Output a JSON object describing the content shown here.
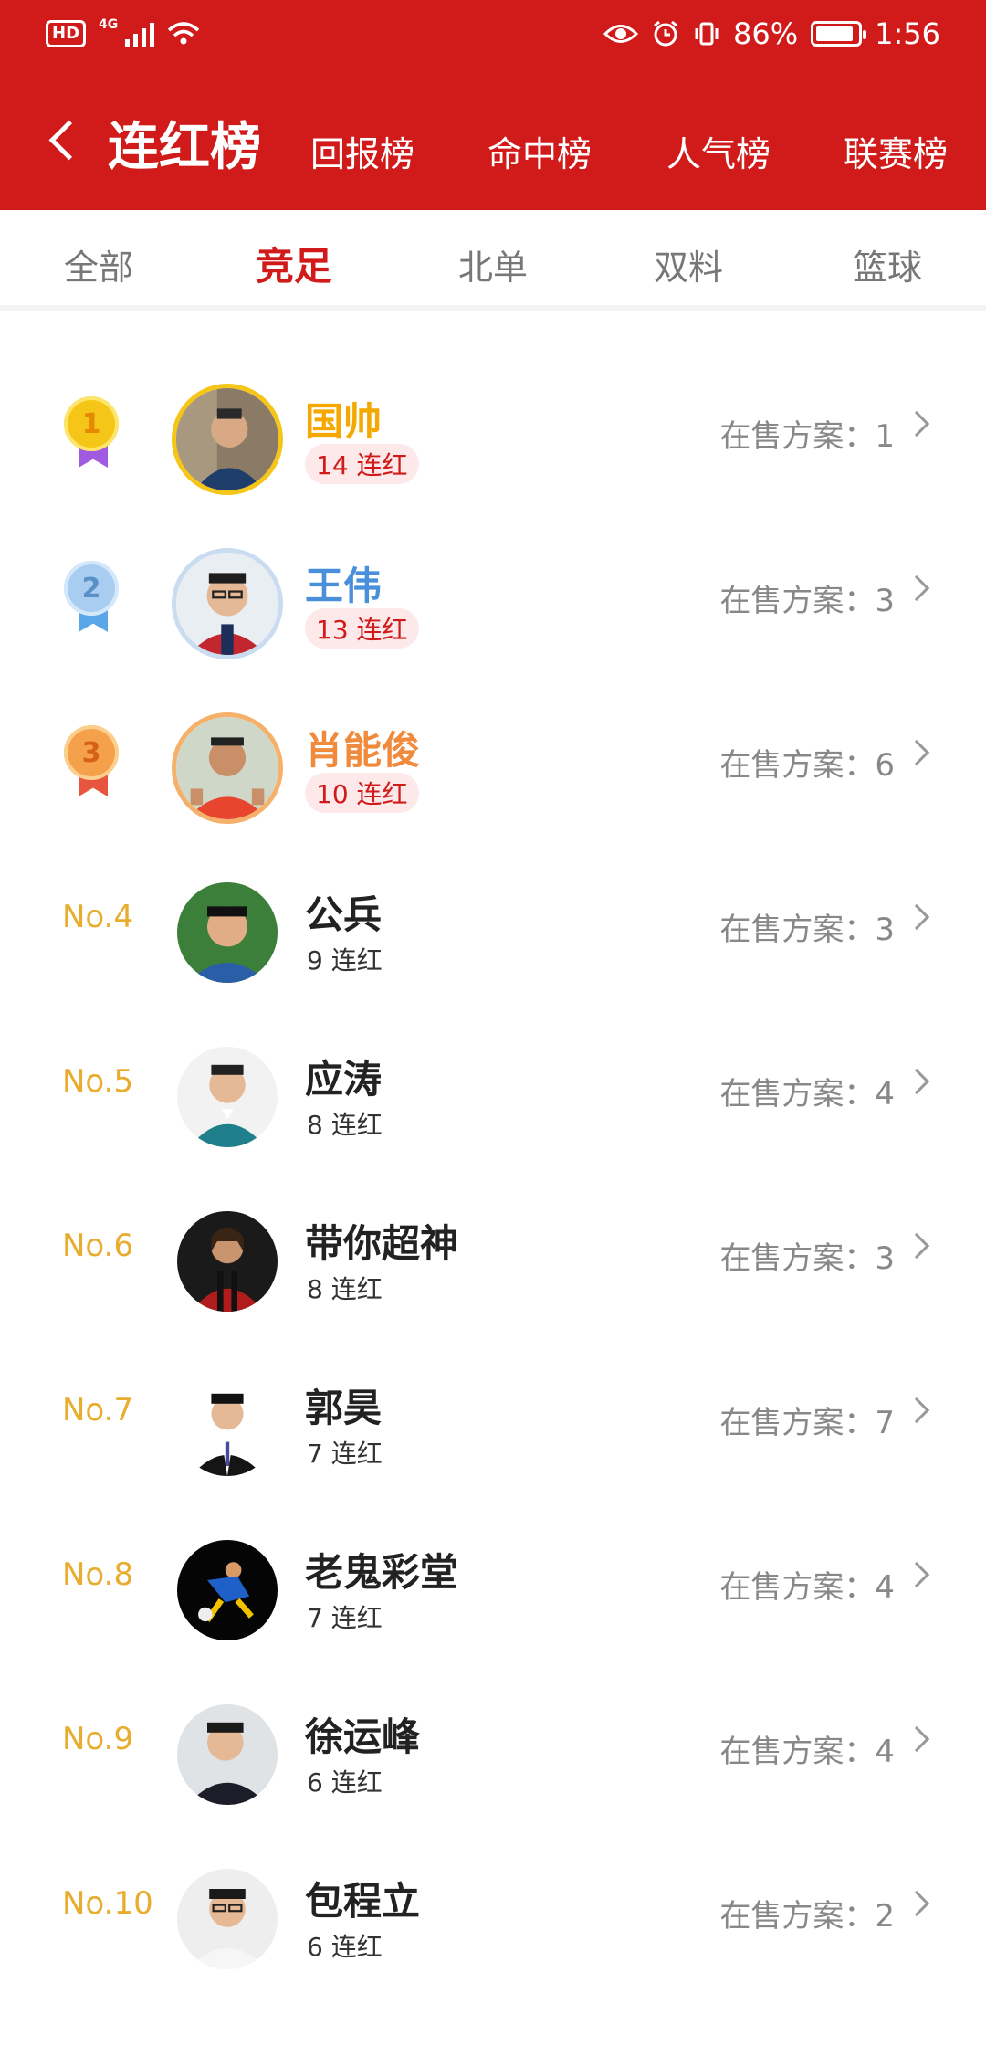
{
  "status_bar": {
    "hd": "HD",
    "network": "4G",
    "battery": "86%",
    "time": "1:56"
  },
  "nav": {
    "title": "连红榜",
    "tabs": [
      "回报榜",
      "命中榜",
      "人气榜",
      "联赛榜"
    ]
  },
  "subtabs": {
    "items": [
      "全部",
      "竞足",
      "北单",
      "双料",
      "篮球"
    ],
    "active": "竞足"
  },
  "onsale_label": "在售方案：",
  "list": [
    {
      "rank": "1",
      "name": "国帅",
      "streak": "14 连红",
      "onsale": "1",
      "name_color": "#f5a800"
    },
    {
      "rank": "2",
      "name": "王伟",
      "streak": "13 连红",
      "onsale": "3",
      "name_color": "#4a8fd9"
    },
    {
      "rank": "3",
      "name": "肖能俊",
      "streak": "10 连红",
      "onsale": "6",
      "name_color": "#f08a3c"
    },
    {
      "rank": "No.4",
      "name": "公兵",
      "streak": "9 连红",
      "onsale": "3"
    },
    {
      "rank": "No.5",
      "name": "应涛",
      "streak": "8 连红",
      "onsale": "4"
    },
    {
      "rank": "No.6",
      "name": "带你超神",
      "streak": "8 连红",
      "onsale": "3"
    },
    {
      "rank": "No.7",
      "name": "郭昊",
      "streak": "7 连红",
      "onsale": "7"
    },
    {
      "rank": "No.8",
      "name": "老鬼彩堂",
      "streak": "7 连红",
      "onsale": "4"
    },
    {
      "rank": "No.9",
      "name": "徐运峰",
      "streak": "6 连红",
      "onsale": "4"
    },
    {
      "rank": "No.10",
      "name": "包程立",
      "streak": "6 连红",
      "onsale": "2"
    }
  ],
  "colors": {
    "brand_red": "#d11a1a",
    "gold": "#f5c518",
    "silver": "#a9cdf0",
    "bronze": "#f5a04a",
    "rank_text": "#e8ad2e"
  }
}
